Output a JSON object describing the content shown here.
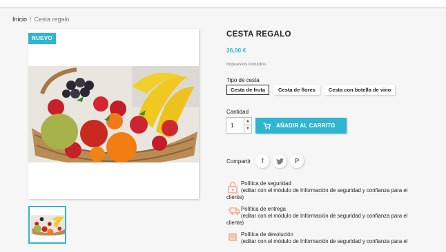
{
  "breadcrumb": {
    "home": "Inicio",
    "separator": "/",
    "current": "Cesta regalo"
  },
  "product": {
    "badge": "NUEVO",
    "title": "CESTA REGALO",
    "price": "26,00 €",
    "tax_note": "Impuestos incluidos",
    "image_icon": "fruit-basket-image",
    "accent_color": "#2fb5d2"
  },
  "variants": {
    "label": "Tipo de cesta",
    "options": [
      "Cesta de fruta",
      "Cesta de flores",
      "Cesta con botella de vino"
    ],
    "selected": "Cesta de fruta"
  },
  "quantity": {
    "label": "Cantidad",
    "value": "1"
  },
  "cart": {
    "button_label": "AÑADIR AL CARRITO",
    "icon": "cart-icon"
  },
  "share": {
    "label": "Compartir",
    "networks": [
      "facebook-icon",
      "twitter-icon",
      "pinterest-icon"
    ]
  },
  "reassurance": [
    {
      "title": "Política de seguridad",
      "desc_a": "(editar con el módulo de Información de seguridad y confianza para el",
      "desc_b": "cliente)",
      "icon": "lock-icon"
    },
    {
      "title": "Política de entrega",
      "desc_a": "(editar con el módulo de Información de seguridad y confianza para el",
      "desc_b": "cliente)",
      "icon": "delivery-truck-icon"
    },
    {
      "title": "Política de devolución",
      "desc_a": "(editar con el módulo de Información de seguridad y confianza para el",
      "icon": "return-icon"
    }
  ]
}
